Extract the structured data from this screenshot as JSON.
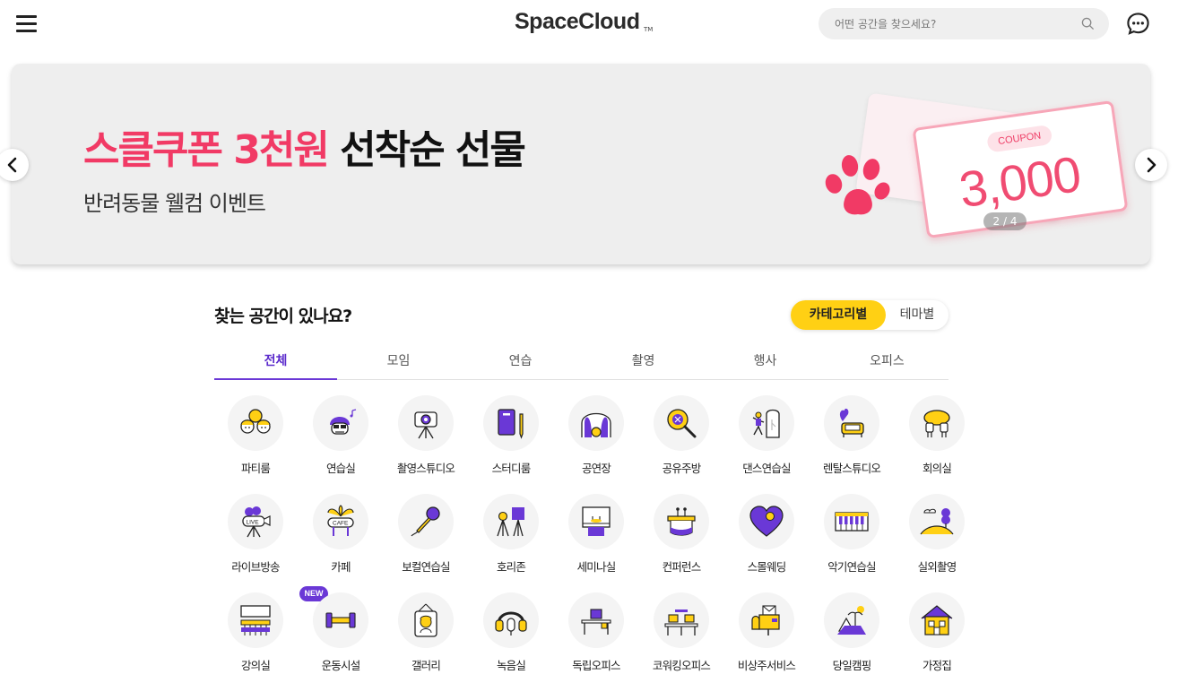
{
  "header": {
    "logo": "SpaceCloud",
    "logo_tm": "TM",
    "search_placeholder": "어떤 공간을 찾으세요?"
  },
  "banner": {
    "title_highlight": "스클쿠폰 3천원",
    "title_rest": "선착순 선물",
    "subtitle": "반려동물 웰컴 이벤트",
    "coupon_label": "COUPON",
    "coupon_amount": "3,000",
    "page_indicator": "2 / 4",
    "accent_color": "#f13a65"
  },
  "section": {
    "title": "찾는 공간이 있나요?",
    "toggle_on": "카테고리별",
    "toggle_off": "테마별",
    "toggle_color": "#ffd014"
  },
  "tabs": [
    "전체",
    "모임",
    "연습",
    "촬영",
    "행사",
    "오피스"
  ],
  "active_tab": "전체",
  "categories": [
    {
      "label": "파티룸",
      "icon": "party-icon"
    },
    {
      "label": "연습실",
      "icon": "practice-room-icon"
    },
    {
      "label": "촬영스튜디오",
      "icon": "camera-studio-icon"
    },
    {
      "label": "스터디룸",
      "icon": "study-room-icon"
    },
    {
      "label": "공연장",
      "icon": "stage-icon"
    },
    {
      "label": "공유주방",
      "icon": "kitchen-icon"
    },
    {
      "label": "댄스연습실",
      "icon": "dance-icon"
    },
    {
      "label": "렌탈스튜디오",
      "icon": "rental-studio-icon"
    },
    {
      "label": "회의실",
      "icon": "meeting-room-icon"
    },
    {
      "label": "라이브방송",
      "icon": "live-broadcast-icon"
    },
    {
      "label": "카페",
      "icon": "cafe-icon"
    },
    {
      "label": "보컬연습실",
      "icon": "microphone-icon"
    },
    {
      "label": "호리존",
      "icon": "horizon-icon"
    },
    {
      "label": "세미나실",
      "icon": "seminar-icon"
    },
    {
      "label": "컨퍼런스",
      "icon": "conference-icon"
    },
    {
      "label": "스몰웨딩",
      "icon": "wedding-heart-icon"
    },
    {
      "label": "악기연습실",
      "icon": "piano-icon"
    },
    {
      "label": "실외촬영",
      "icon": "outdoor-icon"
    },
    {
      "label": "강의실",
      "icon": "lecture-room-icon"
    },
    {
      "label": "운동시설",
      "icon": "dumbbell-icon",
      "badge": "NEW"
    },
    {
      "label": "갤러리",
      "icon": "gallery-icon"
    },
    {
      "label": "녹음실",
      "icon": "headphones-icon"
    },
    {
      "label": "독립오피스",
      "icon": "office-icon"
    },
    {
      "label": "코워킹오피스",
      "icon": "coworking-icon"
    },
    {
      "label": "비상주서비스",
      "icon": "mailbox-icon"
    },
    {
      "label": "당일캠핑",
      "icon": "camping-icon"
    },
    {
      "label": "가정집",
      "icon": "house-icon"
    }
  ],
  "colors": {
    "purple": "#6a38d6",
    "yellow": "#ffd014"
  }
}
